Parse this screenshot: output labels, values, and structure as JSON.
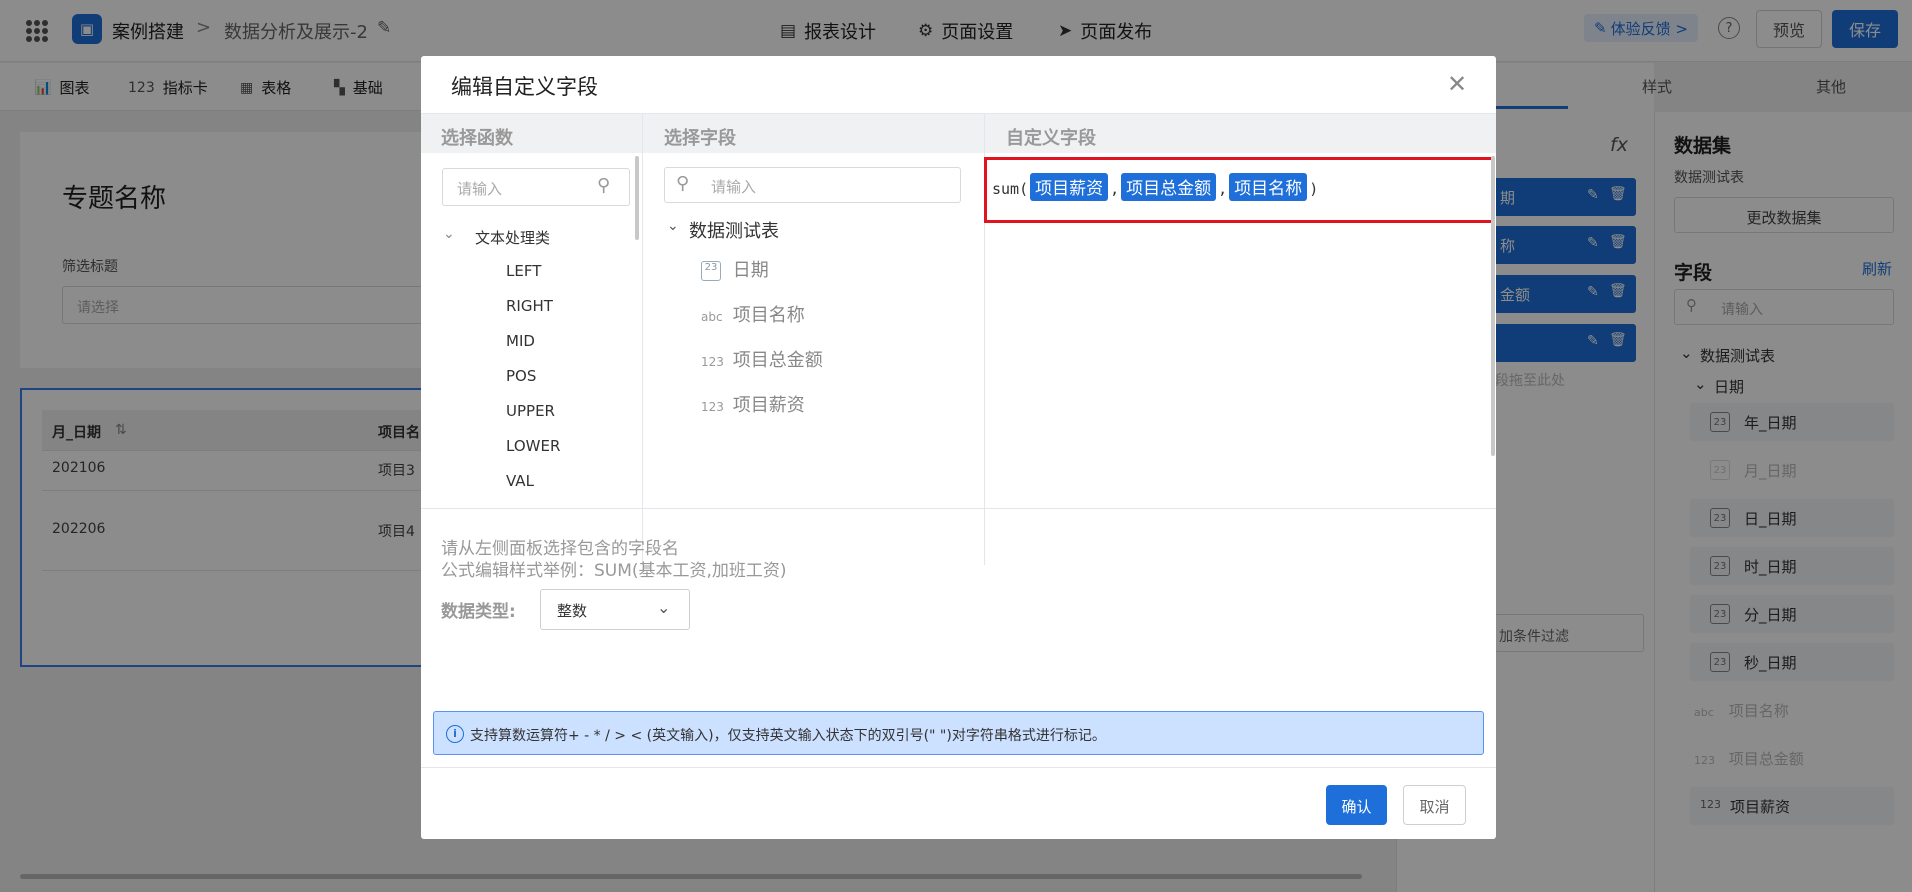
{
  "header": {
    "breadcrumb_root": "案例搭建",
    "breadcrumb_sep": ">",
    "breadcrumb_page": "数据分析及展示-2",
    "nav": [
      "报表设计",
      "页面设置",
      "页面发布"
    ],
    "feedback": "体验反馈 >",
    "help": "?",
    "preview": "预览",
    "save": "保存"
  },
  "toolbar": {
    "items": [
      "图表",
      "指标卡",
      "表格",
      "基础"
    ]
  },
  "canvas": {
    "topic_title": "专题名称",
    "filter_label": "筛选标题",
    "filter_placeholder": "请选择",
    "table": {
      "headers": [
        "月_日期",
        "项目名"
      ],
      "rows": [
        [
          "202106",
          "项目3"
        ],
        [
          "202206",
          "项目4"
        ]
      ]
    }
  },
  "properties": {
    "tabs": [
      "样式",
      "其他"
    ],
    "fx": "fx",
    "slots": [
      "期",
      "称",
      "金额",
      ""
    ],
    "drag_hint": "段拖至此处",
    "add_filter": "加条件过滤"
  },
  "dataset_panel": {
    "title": "数据集",
    "dataset_name": "数据测试表",
    "change": "更改数据集",
    "fields_title": "字段",
    "refresh": "刷新",
    "search_placeholder": "请输入",
    "tree_root": "数据测试表",
    "date_group": "日期",
    "date_fields": [
      "年_日期",
      "月_日期",
      "日_日期",
      "时_日期",
      "分_日期",
      "秒_日期"
    ],
    "other_fields": [
      {
        "tag": "abc",
        "name": "项目名称"
      },
      {
        "tag": "123",
        "name": "项目总金额"
      },
      {
        "tag": "123",
        "name": "项目薪资"
      }
    ]
  },
  "dialog": {
    "title": "编辑自定义字段",
    "columns": [
      "选择函数",
      "选择字段",
      "自定义字段"
    ],
    "function_search_placeholder": "请输入",
    "function_category": "文本处理类",
    "functions": [
      "LEFT",
      "RIGHT",
      "MID",
      "POS",
      "UPPER",
      "LOWER",
      "VAL"
    ],
    "field_search_placeholder": "请输入",
    "field_table": "数据测试表",
    "fields": [
      {
        "tag": "23",
        "name": "日期"
      },
      {
        "tag": "abc",
        "name": "项目名称"
      },
      {
        "tag": "123",
        "name": "项目总金额"
      },
      {
        "tag": "123",
        "name": "项目薪资"
      }
    ],
    "formula": {
      "func": "sum(",
      "tokens": [
        "项目薪资",
        "项目总金额",
        "项目名称"
      ],
      "sep": ",",
      "close": ")"
    },
    "tip_line1": "请从左侧面板选择包含的字段名",
    "tip_line2": "公式编辑样式举例：SUM(基本工资,加班工资)",
    "data_type_label": "数据类型:",
    "data_type_value": "整数",
    "info": "支持算数运算符+ - * / > < (英文输入)，仅支持英文输入状态下的双引号(\" \")对字符串格式进行标记。",
    "confirm": "确认",
    "cancel": "取消"
  },
  "colors": {
    "accent": "#1e6fd9",
    "highlight_border": "#e3131e",
    "info_bg": "#cce0ff"
  }
}
